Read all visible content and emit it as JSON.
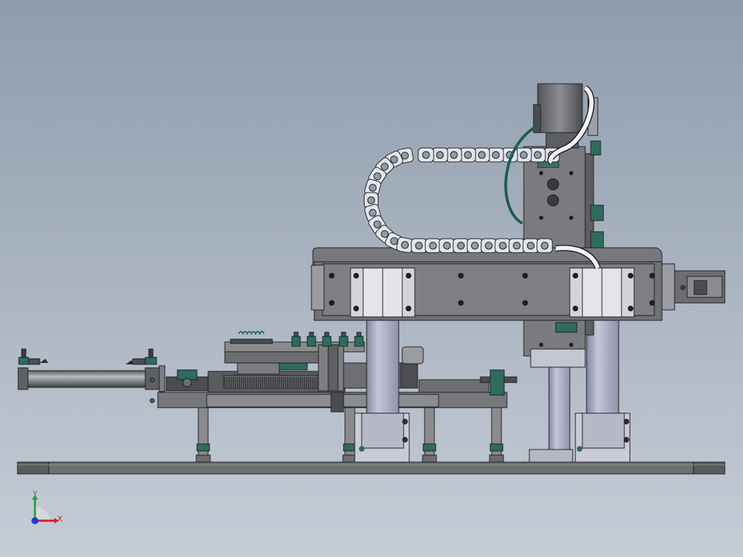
{
  "viewport": {
    "background_top": "#8e9cac",
    "background_bottom": "#c6ccd6"
  },
  "colors": {
    "steel": "#76777b",
    "steel_dark": "#4c4d50",
    "steel_light": "#a3a5aa",
    "column": "#aeb1c6",
    "column_shadow": "#8487a0",
    "outline": "#1e1f22",
    "teal": "#2f6b5f",
    "teal_cable": "#1f5a52",
    "white_cable": "#f2f2f2",
    "plate_light": "#d0d3da"
  },
  "view_triad": {
    "x_label": "X",
    "y_label": "Y",
    "x_color": "#d11f1f",
    "y_color": "#27a13a",
    "z_color": "#1f3fd1",
    "icon": "view-orientation-triad-icon"
  }
}
